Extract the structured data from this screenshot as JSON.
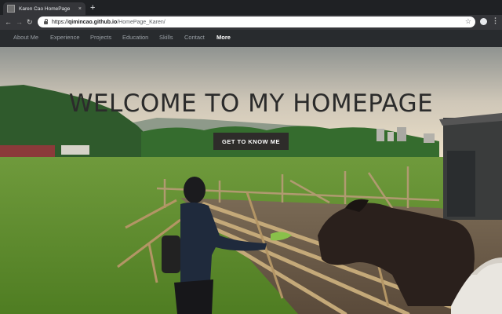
{
  "browser": {
    "tab_title": "Karen Cao HomePage",
    "tab_close": "×",
    "new_tab": "+",
    "back": "←",
    "forward": "→",
    "reload": "↻",
    "url_scheme": "https://",
    "url_host": "qimincao.github.io",
    "url_path": "/HomePage_Karen/",
    "bookmark": "☆",
    "menu": "⋮"
  },
  "sitenav": {
    "items": [
      "About Me",
      "Experience",
      "Projects",
      "Education",
      "Skills",
      "Contact",
      "More"
    ],
    "active": "More"
  },
  "hero": {
    "title": "WELCOME TO MY HOMEPAGE",
    "cta_label": "GET TO KNOW ME"
  },
  "colors": {
    "nav_bg": "#282b2e",
    "cta_bg": "#2e2c2a",
    "title_color": "#2b2b2b"
  },
  "icons": [
    "favicon-icon",
    "close-icon",
    "new-tab-icon",
    "back-icon",
    "forward-icon",
    "reload-icon",
    "lock-icon",
    "star-icon",
    "profile-icon",
    "menu-icon"
  ]
}
